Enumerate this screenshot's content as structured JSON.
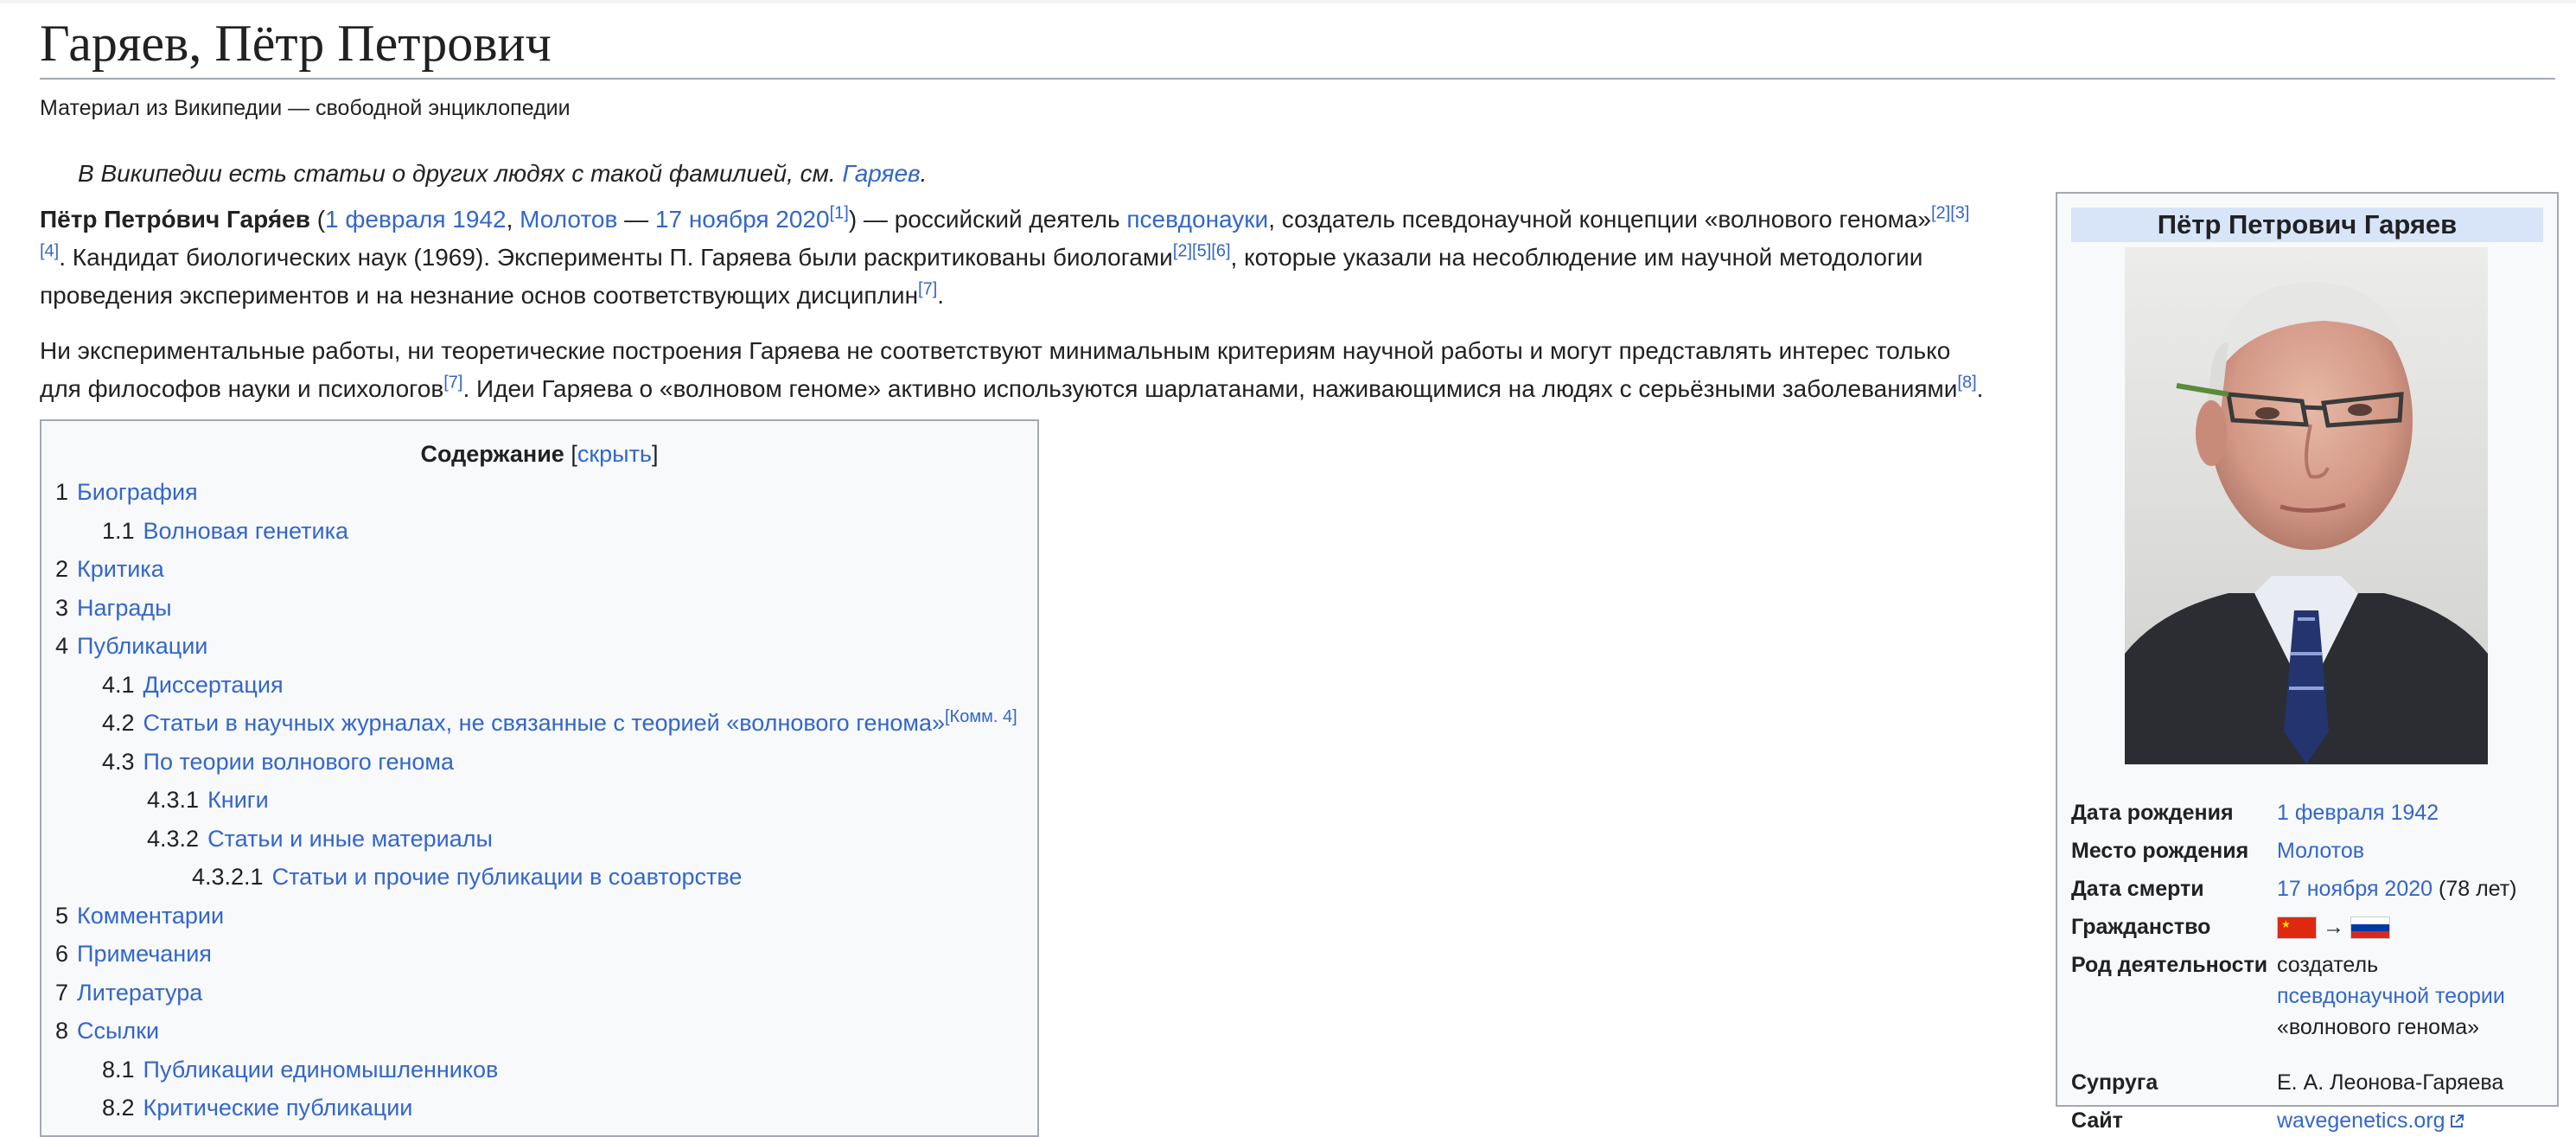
{
  "page": {
    "title": "Гаряев, Пётр Петрович",
    "tagline": "Материал из Википедии — свободной энциклопедии",
    "hatnote": {
      "prefix": "В Википедии есть статьи о других людях с такой фамилией, см. ",
      "link": "Гаряев",
      "suffix": "."
    }
  },
  "intro": {
    "p1": {
      "name_bold": "Пётр Петро́вич Гаря́ев",
      "open_paren": " (",
      "birth_date": "1 февраля 1942",
      "comma": ", ",
      "birth_place": "Молотов",
      "dash": " — ",
      "death_date": "17 ноября 2020",
      "ref1": "[1]",
      "text_a": ") — российский деятель ",
      "pseudoscience": "псевдонауки",
      "text_b": ", создатель псевдонаучной концепции «волнового генома»",
      "ref2": "[2]",
      "ref3": "[3]",
      "ref4": "[4]",
      "text_c": ". Кандидат биологических наук (1969). Эксперименты П. Гаряева были раскритикованы биологами",
      "ref2b": "[2]",
      "ref5": "[5]",
      "ref6": "[6]",
      "text_d": ", которые указали на несоблюдение им научной методологии",
      "text_e": "проведения экспериментов и на незнание основ соответствующих дисциплин",
      "ref7": "[7]",
      "text_f": "."
    },
    "p2": {
      "line1": "Ни экспериментальные работы, ни теоретические построения Гаряева не соответствуют минимальным критериям научной работы и могут представлять интерес только",
      "line2a": "для философов науки и психологов",
      "ref7": "[7]",
      "line2b": ". Идеи Гаряева о «волновом геноме» активно используются шарлатанами, наживающимися на людях с серьёзными заболеваниями",
      "ref8": "[8]",
      "line2c": "."
    }
  },
  "toc": {
    "title": "Содержание",
    "toggle_open": " [",
    "toggle": "скрыть",
    "toggle_close": "]",
    "items": [
      {
        "num": "1",
        "label": "Биография",
        "level": 1
      },
      {
        "num": "1.1",
        "label": "Волновая генетика",
        "level": 2
      },
      {
        "num": "2",
        "label": "Критика",
        "level": 1
      },
      {
        "num": "3",
        "label": "Награды",
        "level": 1
      },
      {
        "num": "4",
        "label": "Публикации",
        "level": 1
      },
      {
        "num": "4.1",
        "label": "Диссертация",
        "level": 2
      },
      {
        "num": "4.2",
        "label": "Статьи в научных журналах, не связанные с теорией «волнового генома»",
        "sup": "[Комм. 4]",
        "level": 2
      },
      {
        "num": "4.3",
        "label": "По теории волнового генома",
        "level": 2
      },
      {
        "num": "4.3.1",
        "label": "Книги",
        "level": 3
      },
      {
        "num": "4.3.2",
        "label": "Статьи и иные материалы",
        "level": 3
      },
      {
        "num": "4.3.2.1",
        "label": "Статьи и прочие публикации в соавторстве",
        "level": 4
      },
      {
        "num": "5",
        "label": "Комментарии",
        "level": 1
      },
      {
        "num": "6",
        "label": "Примечания",
        "level": 1
      },
      {
        "num": "7",
        "label": "Литература",
        "level": 1
      },
      {
        "num": "8",
        "label": "Ссылки",
        "level": 1
      },
      {
        "num": "8.1",
        "label": "Публикации единомышленников",
        "level": 2
      },
      {
        "num": "8.2",
        "label": "Критические публикации",
        "level": 2
      }
    ]
  },
  "infobox": {
    "title": "Пётр Петрович Гаряев",
    "rows": {
      "birth_date": {
        "label": "Дата рождения",
        "value": "1 февраля 1942"
      },
      "birth_place": {
        "label": "Место рождения",
        "value": "Молотов"
      },
      "death_date": {
        "label": "Дата смерти",
        "value": "17 ноября 2020",
        "extra": " (78 лет)"
      },
      "citizenship": {
        "label": "Гражданство",
        "arrow": " → "
      },
      "occupation": {
        "label": "Род деятельности",
        "line1": "создатель",
        "link": "псевдонаучной теории",
        "line3": "«волнового генома»"
      },
      "spouse": {
        "label": "Супруга",
        "value": "Е. А. Леонова-Гаряева"
      },
      "website": {
        "label": "Сайт",
        "value": "wavegenetics.org"
      }
    }
  },
  "colors": {
    "link": "#3366cc",
    "text": "#202122",
    "infobox_header": "#d8e4f8",
    "border": "#a2a9b1"
  }
}
